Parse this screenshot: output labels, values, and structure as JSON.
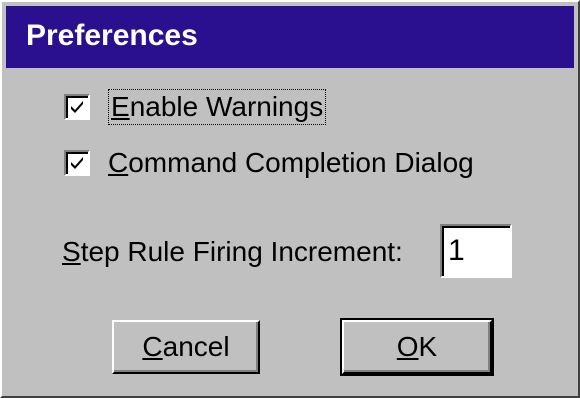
{
  "window": {
    "title": "Preferences",
    "title_bar_color": "#2a108f",
    "background_color": "#c0c0c0"
  },
  "options": {
    "enable_warnings": {
      "mnemonic": "E",
      "rest": "nable Warnings",
      "checked": true,
      "focused": true
    },
    "command_completion": {
      "mnemonic": "C",
      "rest": "ommand Completion Dialog",
      "checked": true
    }
  },
  "step_increment": {
    "label_mnemonic": "S",
    "label_rest": "tep Rule Firing Increment:",
    "value": "1"
  },
  "buttons": {
    "cancel_mnemonic": "C",
    "cancel_rest": "ancel",
    "ok_mnemonic": "O",
    "ok_rest": "K"
  }
}
